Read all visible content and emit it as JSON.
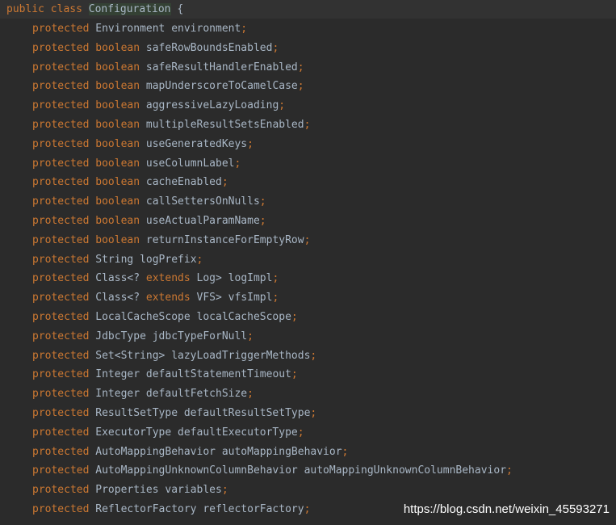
{
  "editor": {
    "header": {
      "kw1": "public",
      "kw2": "class",
      "name": "Configuration",
      "brace": "{"
    },
    "fields": [
      {
        "mod": "protected",
        "kind": "plain",
        "type": "Environment",
        "name": "environment"
      },
      {
        "mod": "protected",
        "kind": "bool",
        "type": "boolean",
        "name": "safeRowBoundsEnabled"
      },
      {
        "mod": "protected",
        "kind": "bool",
        "type": "boolean",
        "name": "safeResultHandlerEnabled"
      },
      {
        "mod": "protected",
        "kind": "bool",
        "type": "boolean",
        "name": "mapUnderscoreToCamelCase"
      },
      {
        "mod": "protected",
        "kind": "bool",
        "type": "boolean",
        "name": "aggressiveLazyLoading"
      },
      {
        "mod": "protected",
        "kind": "bool",
        "type": "boolean",
        "name": "multipleResultSetsEnabled"
      },
      {
        "mod": "protected",
        "kind": "bool",
        "type": "boolean",
        "name": "useGeneratedKeys"
      },
      {
        "mod": "protected",
        "kind": "bool",
        "type": "boolean",
        "name": "useColumnLabel"
      },
      {
        "mod": "protected",
        "kind": "bool",
        "type": "boolean",
        "name": "cacheEnabled"
      },
      {
        "mod": "protected",
        "kind": "bool",
        "type": "boolean",
        "name": "callSettersOnNulls"
      },
      {
        "mod": "protected",
        "kind": "bool",
        "type": "boolean",
        "name": "useActualParamName"
      },
      {
        "mod": "protected",
        "kind": "bool",
        "type": "boolean",
        "name": "returnInstanceForEmptyRow"
      },
      {
        "mod": "protected",
        "kind": "plain",
        "type": "String",
        "name": "logPrefix"
      },
      {
        "mod": "protected",
        "kind": "generic",
        "type": "Class<?",
        "ext": "extends",
        "bound": "Log>",
        "name": "logImpl"
      },
      {
        "mod": "protected",
        "kind": "generic",
        "type": "Class<?",
        "ext": "extends",
        "bound": "VFS>",
        "name": "vfsImpl"
      },
      {
        "mod": "protected",
        "kind": "plain",
        "type": "LocalCacheScope",
        "name": "localCacheScope"
      },
      {
        "mod": "protected",
        "kind": "plain",
        "type": "JdbcType",
        "name": "jdbcTypeForNull"
      },
      {
        "mod": "protected",
        "kind": "plain",
        "type": "Set<String>",
        "name": "lazyLoadTriggerMethods"
      },
      {
        "mod": "protected",
        "kind": "plain",
        "type": "Integer",
        "name": "defaultStatementTimeout"
      },
      {
        "mod": "protected",
        "kind": "plain",
        "type": "Integer",
        "name": "defaultFetchSize"
      },
      {
        "mod": "protected",
        "kind": "plain",
        "type": "ResultSetType",
        "name": "defaultResultSetType"
      },
      {
        "mod": "protected",
        "kind": "plain",
        "type": "ExecutorType",
        "name": "defaultExecutorType"
      },
      {
        "mod": "protected",
        "kind": "plain",
        "type": "AutoMappingBehavior",
        "name": "autoMappingBehavior"
      },
      {
        "mod": "protected",
        "kind": "plain",
        "type": "AutoMappingUnknownColumnBehavior",
        "name": "autoMappingUnknownColumnBehavior"
      },
      {
        "mod": "protected",
        "kind": "plain",
        "type": "Properties",
        "name": "variables"
      },
      {
        "mod": "protected",
        "kind": "plain",
        "type": "ReflectorFactory",
        "name": "reflectorFactory"
      }
    ],
    "semicolon": ";"
  },
  "watermark": "https://blog.csdn.net/weixin_45593271",
  "colors": {
    "background": "#2b2b2b",
    "keyword": "#cc7832",
    "text": "#a9b7c6",
    "class_highlight": "#344134"
  }
}
